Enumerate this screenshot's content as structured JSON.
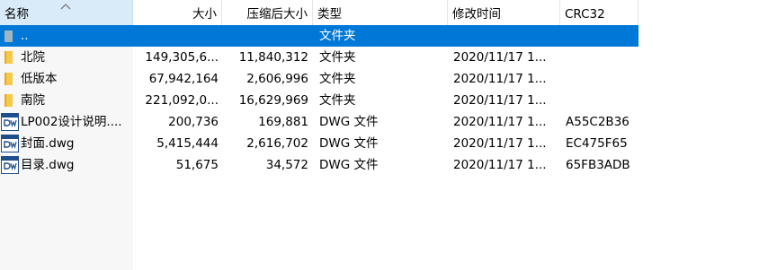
{
  "columns": {
    "name": "名称",
    "size": "大小",
    "packed": "压缩后大小",
    "type": "类型",
    "modified": "修改时间",
    "crc": "CRC32"
  },
  "colors": {
    "selection": "#0078d7",
    "header_active": "#d9ebf9",
    "folder": "#f7c948",
    "dwg_icon": "#1f4e8c"
  },
  "rows": [
    {
      "icon": "parent-folder-icon",
      "name": "..",
      "size": "",
      "packed": "",
      "type": "文件夹",
      "modified": "",
      "crc": "",
      "selected": true
    },
    {
      "icon": "folder-icon",
      "name": "北院",
      "size": "149,305,6...",
      "packed": "11,840,312",
      "type": "文件夹",
      "modified": "2020/11/17 1...",
      "crc": ""
    },
    {
      "icon": "folder-icon",
      "name": "低版本",
      "size": "67,942,164",
      "packed": "2,606,996",
      "type": "文件夹",
      "modified": "2020/11/17 1...",
      "crc": ""
    },
    {
      "icon": "folder-icon",
      "name": "南院",
      "size": "221,092,0...",
      "packed": "16,629,969",
      "type": "文件夹",
      "modified": "2020/11/17 1...",
      "crc": ""
    },
    {
      "icon": "dwg-file-icon",
      "name": "LP002设计说明....",
      "size": "200,736",
      "packed": "169,881",
      "type": "DWG 文件",
      "modified": "2020/11/17 1...",
      "crc": "A55C2B36"
    },
    {
      "icon": "dwg-file-icon",
      "name": "封面.dwg",
      "size": "5,415,444",
      "packed": "2,616,702",
      "type": "DWG 文件",
      "modified": "2020/11/17 1...",
      "crc": "EC475F65"
    },
    {
      "icon": "dwg-file-icon",
      "name": "目录.dwg",
      "size": "51,675",
      "packed": "34,572",
      "type": "DWG 文件",
      "modified": "2020/11/17 1...",
      "crc": "65FB3ADB"
    }
  ]
}
